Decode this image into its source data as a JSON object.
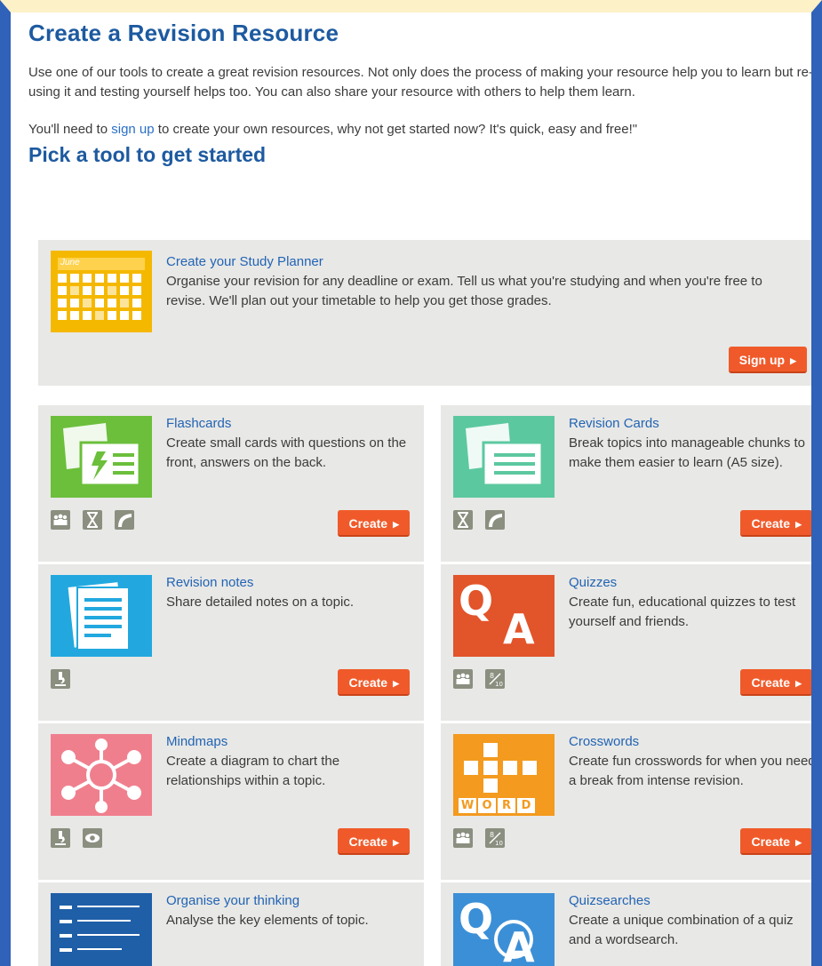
{
  "header": {
    "title": "Create a Revision Resource",
    "intro": "Use one of our tools to create a great revision resources. Not only does the process of making your resource help you to learn but re-using it and testing yourself helps too. You can also share your resource with others to help them learn.",
    "signup_pre": "You'll need to ",
    "signup_link": "sign up",
    "signup_post": " to create your own resources, why not get started now? It's quick, easy and free!\"",
    "pick_title": "Pick a tool to get started"
  },
  "planner": {
    "title": "Create your Study Planner",
    "desc": "Organise your revision for any deadline or exam. Tell us what you're studying and when you're free to revise. We'll plan out your timetable to help you get those grades.",
    "calendar_label": "June",
    "button": "Sign up"
  },
  "tools": [
    {
      "title": "Flashcards",
      "desc": "Create small cards with questions on the front, answers on the back.",
      "button": "Create",
      "color": "#6bbf3b"
    },
    {
      "title": "Revision Cards",
      "desc": "Break topics into manageable chunks to make them easier to learn (A5 size).",
      "button": "Create",
      "color": "#5cc8a0"
    },
    {
      "title": "Revision notes",
      "desc": "Share detailed notes on a topic.",
      "button": "Create",
      "color": "#22a8df"
    },
    {
      "title": "Quizzes",
      "desc": "Create fun, educational quizzes to test yourself and friends.",
      "button": "Create",
      "color": "#e2542a",
      "letter1": "Q",
      "letter2": "A"
    },
    {
      "title": "Mindmaps",
      "desc": "Create a diagram to chart the relationships within a topic.",
      "button": "Create",
      "color": "#f07f8e"
    },
    {
      "title": "Crosswords",
      "desc": "Create fun crosswords for when you need a break from intense revision.",
      "button": "Create",
      "color": "#f39a1f",
      "word": [
        "W",
        "O",
        "R",
        "D"
      ]
    },
    {
      "title": "Organise your thinking",
      "desc": "Analyse the key elements of topic.",
      "color": "#1f5fa8"
    },
    {
      "title": "Quizsearches",
      "desc": "Create a unique combination of a quiz and a wordsearch.",
      "color": "#3b8fd6",
      "letter1": "Q",
      "letter2": "A"
    }
  ],
  "score_icon": {
    "top": "8",
    "bottom": "10"
  }
}
